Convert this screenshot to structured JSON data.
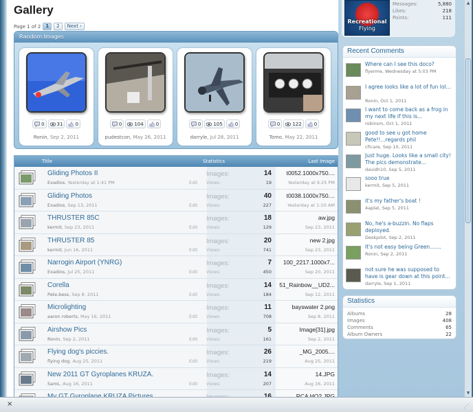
{
  "page": {
    "title": "Gallery"
  },
  "pager": {
    "text": "Page 1 of 2",
    "pages": [
      "1",
      "2"
    ],
    "next": "Next ›"
  },
  "random": {
    "header": "Random Images",
    "items": [
      {
        "comments": "0",
        "views": "31",
        "likes": "0",
        "user": "Ronin",
        "date": "Sep 2, 2011"
      },
      {
        "comments": "0",
        "views": "104",
        "likes": "0",
        "user": "pudestcon",
        "date": "May 26, 2011"
      },
      {
        "comments": "0",
        "views": "105",
        "likes": "0",
        "user": "darryle",
        "date": "Jul 28, 2011"
      },
      {
        "comments": "0",
        "views": "122",
        "likes": "0",
        "user": "Tomo",
        "date": "May 22, 2011"
      }
    ]
  },
  "table": {
    "col_title": "Title",
    "col_stats": "Statistics",
    "col_last": "Last Image",
    "images_label": "Images:",
    "views_label": "Views:",
    "edit": "Edit",
    "rows": [
      {
        "name": "Gliding Photos II",
        "user": "Exadios",
        "date": "Yesterday at 1:41 PM",
        "images": "14",
        "views": "19",
        "last": "t0052.1000x750....",
        "last_date": "Yesterday at 9:25 PM"
      },
      {
        "name": "Gliding Photos",
        "user": "Exadios",
        "date": "Sep 13, 2011",
        "images": "40",
        "views": "227",
        "last": "t0038.1000x750....",
        "last_date": "Yesterday at 1:10 AM"
      },
      {
        "name": "THRUSTER 85C",
        "user": "kermit",
        "date": "Sep 23, 2011",
        "images": "18",
        "views": "129",
        "last": "aw.jpg",
        "last_date": "Sep 23, 2011"
      },
      {
        "name": "THRUSTER 85",
        "user": "kermit",
        "date": "Jun 16, 2011",
        "images": "20",
        "views": "741",
        "last": "new 2.jpg",
        "last_date": "Sep 23, 2011"
      },
      {
        "name": "Narrogin Airport (YNRG)",
        "user": "Exadios",
        "date": "Jul 25, 2011",
        "images": "7",
        "views": "450",
        "last": "100_2217.1000x7...",
        "last_date": "Sep 20, 2011"
      },
      {
        "name": "Corella",
        "user": "Pete.bess",
        "date": "Sep 8, 2011",
        "images": "14",
        "views": "184",
        "last": "51_Rainbow__UD2...",
        "last_date": "Sep 12, 2011"
      },
      {
        "name": "Microlighting",
        "user": "aaron roberts",
        "date": "May 16, 2011",
        "images": "11",
        "views": "708",
        "last": "bayswater 2.png",
        "last_date": "Sep 8, 2011"
      },
      {
        "name": "Airshow Pics",
        "user": "Ronin",
        "date": "Sep 2, 2011",
        "images": "5",
        "views": "161",
        "last": "Image[31].jpg",
        "last_date": "Sep 2, 2011"
      },
      {
        "name": "Flying dog's piccies.",
        "user": "flying dog",
        "date": "Aug 25, 2011",
        "images": "26",
        "views": "219",
        "last": "_MG_2005....",
        "last_date": "Aug 25, 2011"
      },
      {
        "name": "New 2011 GT Gyroplanes KRUZA.",
        "user": "SamL",
        "date": "Aug 16, 2011",
        "images": "14",
        "views": "207",
        "last": "14.JPG",
        "last_date": "Aug 16, 2011"
      },
      {
        "name": "My GT Gyroplane KRUZA Pictures",
        "user": "",
        "date": "",
        "images": "16",
        "views": "",
        "last": "RCA HO2.JPG",
        "last_date": ""
      }
    ]
  },
  "profile": {
    "logo_line1": "Recreational",
    "logo_line2": "Flying",
    "messages_label": "Messages:",
    "messages": "5,880",
    "likes_label": "Likes:",
    "likes": "218",
    "points_label": "Points:",
    "points": "111"
  },
  "recent": {
    "title": "Recent Comments",
    "items": [
      {
        "text": "Where can I see this doco?",
        "user": "flyerme",
        "date": "Wednesday at 5:03 PM"
      },
      {
        "text": "I agree looks like a lot of fun lol...",
        "user": "Ronin",
        "date": "Oct 1, 2011"
      },
      {
        "text": "I want to come back as a frog in my next life if this is...",
        "user": "robinsm",
        "date": "Oct 1, 2011"
      },
      {
        "text": "good to see u got home Pete!!...regards phil",
        "user": "cficare",
        "date": "Sep 10, 2011"
      },
      {
        "text": "Just huge. Looks like a small city! The pics demonstrate...",
        "user": "davidh10",
        "date": "Sep 5, 2011"
      },
      {
        "text": "sooo true",
        "user": "kermit",
        "date": "Sep 5, 2011"
      },
      {
        "text": "it's my father's boat !",
        "user": "4aplat",
        "date": "Sep 5, 2011"
      },
      {
        "text": "No, he's a-buzzin. No flaps deployed.",
        "user": "Deskpilot",
        "date": "Sep 2, 2011"
      },
      {
        "text": "It's not easy being Green.......",
        "user": "Ronin",
        "date": "Sep 2, 2011"
      },
      {
        "text": "not sure he was supposed to have is gear down at this point...",
        "user": "darryle",
        "date": "Sep 1, 2011"
      }
    ]
  },
  "stats": {
    "title": "Statistics",
    "items": [
      {
        "label": "Albums",
        "value": "28"
      },
      {
        "label": "Images",
        "value": "408"
      },
      {
        "label": "Comments",
        "value": "65"
      },
      {
        "label": "Album Owners",
        "value": "22"
      }
    ]
  },
  "statusbar": {
    "close": "×"
  },
  "colors": {
    "accent": "#2a6899",
    "header_blue": "#5b90ba"
  }
}
